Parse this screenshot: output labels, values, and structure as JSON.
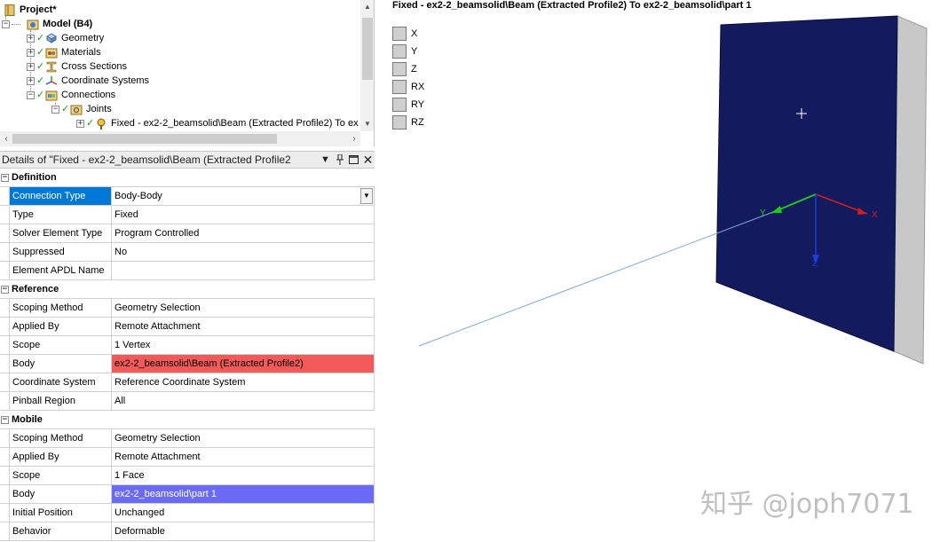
{
  "tree": {
    "items": [
      {
        "label": "Project*"
      },
      {
        "label": "Model (B4)"
      },
      {
        "label": "Geometry"
      },
      {
        "label": "Materials"
      },
      {
        "label": "Cross Sections"
      },
      {
        "label": "Coordinate Systems"
      },
      {
        "label": "Connections"
      },
      {
        "label": "Joints"
      },
      {
        "label": "Fixed - ex2-2_beamsolid\\Beam (Extracted Profile2) To ex"
      }
    ],
    "expanded_glyph": "−",
    "collapsed_glyph": "+",
    "check_glyph": "✓"
  },
  "details": {
    "title": "Details of \"Fixed - ex2-2_beamsolid\\Beam (Extracted Profile2",
    "groups": [
      {
        "label": "Definition",
        "rows": [
          {
            "name": "Connection Type",
            "value": "Body-Body"
          },
          {
            "name": "Type",
            "value": "Fixed"
          },
          {
            "name": "Solver Element Type",
            "value": "Program Controlled"
          },
          {
            "name": "Suppressed",
            "value": "No"
          },
          {
            "name": "Element APDL Name",
            "value": ""
          }
        ]
      },
      {
        "label": "Reference",
        "rows": [
          {
            "name": "Scoping Method",
            "value": "Geometry Selection"
          },
          {
            "name": "Applied By",
            "value": "Remote Attachment"
          },
          {
            "name": "Scope",
            "value": "1 Vertex"
          },
          {
            "name": "Body",
            "value": "ex2-2_beamsolid\\Beam (Extracted Profile2)"
          },
          {
            "name": "Coordinate System",
            "value": "Reference Coordinate System"
          },
          {
            "name": "Pinball Region",
            "value": "All"
          }
        ]
      },
      {
        "label": "Mobile",
        "rows": [
          {
            "name": "Scoping Method",
            "value": "Geometry Selection"
          },
          {
            "name": "Applied By",
            "value": "Remote Attachment"
          },
          {
            "name": "Scope",
            "value": "1 Face"
          },
          {
            "name": "Body",
            "value": "ex2-2_beamsolid\\part 1"
          },
          {
            "name": "Initial Position",
            "value": "Unchanged"
          },
          {
            "name": "Behavior",
            "value": "Deformable"
          }
        ]
      }
    ],
    "colors": {
      "selected": "#0078d7",
      "reference_body": "#f25a5a",
      "mobile_body": "#6a6af7"
    }
  },
  "viewport": {
    "title": "Fixed - ex2-2_beamsolid\\Beam (Extracted Profile2) To ex2-2_beamsolid\\part 1",
    "dofs": [
      "X",
      "Y",
      "Z",
      "RX",
      "RY",
      "RZ"
    ],
    "triad": {
      "x": "X",
      "y": "Y",
      "z": "Z"
    },
    "colors": {
      "plate_face": "#131a5e",
      "plate_edge": "#c8c8c8",
      "x_axis": "#d21e1e",
      "y_axis": "#1ec81e",
      "z_axis": "#1e3cd2",
      "beam_line": "#7fa8d8"
    }
  },
  "watermark": "知乎 @joph7071"
}
